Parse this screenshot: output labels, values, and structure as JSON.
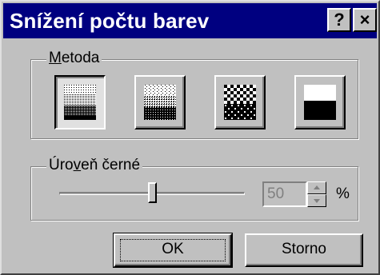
{
  "dialog": {
    "title": "Snížení počtu barev",
    "help_button": "?",
    "close_button": "×"
  },
  "method_group": {
    "label_accel": "M",
    "label_rest": "etoda",
    "options": [
      {
        "name": "ordered-dither",
        "selected": true
      },
      {
        "name": "error-diffusion",
        "selected": false
      },
      {
        "name": "pattern-dither",
        "selected": false
      },
      {
        "name": "threshold",
        "selected": false
      }
    ]
  },
  "black_level": {
    "label_pre": "Úro",
    "label_accel": "v",
    "label_post": "eň černé",
    "value": "50",
    "unit": "%",
    "slider_fraction": 0.5,
    "enabled": false
  },
  "buttons": {
    "ok": "OK",
    "cancel": "Storno"
  }
}
